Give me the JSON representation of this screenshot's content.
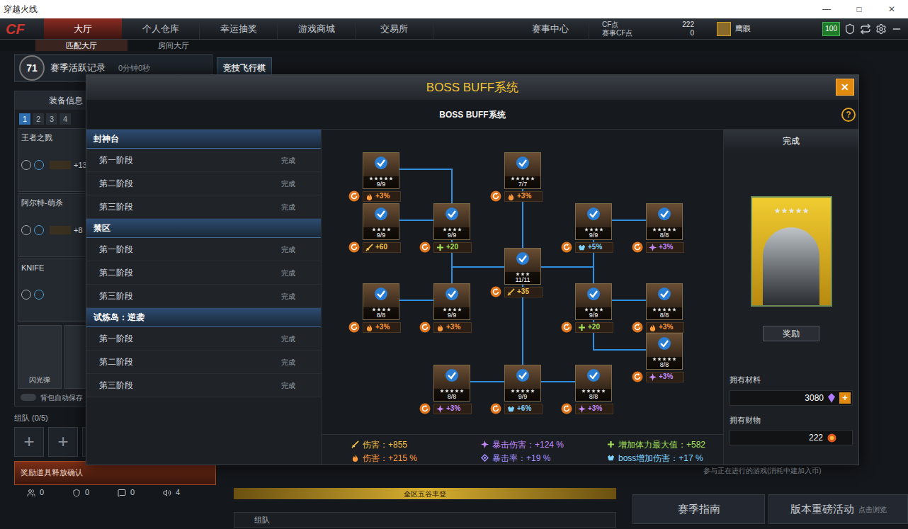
{
  "window": {
    "title": "穿越火线",
    "controls": [
      "—",
      "□",
      "✕"
    ]
  },
  "nav": {
    "logo": "CF",
    "tabs": [
      {
        "label": "大厅",
        "selected": true
      },
      {
        "label": "个人仓库",
        "selected": false
      },
      {
        "label": "幸运抽奖",
        "selected": false
      },
      {
        "label": "游戏商城",
        "selected": false
      },
      {
        "label": "交易所",
        "selected": false
      },
      {
        "label": "赛事中心",
        "selected": false
      }
    ],
    "currencies": [
      {
        "label": "CF点",
        "value": "222"
      },
      {
        "label": "赛事CF点",
        "value": "0"
      }
    ],
    "player": "鹰眼",
    "level_badge": "100",
    "subtabs": [
      {
        "label": "匹配大厅",
        "selected": true
      },
      {
        "label": "房间大厅",
        "selected": false
      }
    ]
  },
  "season": {
    "rank": "71",
    "label": "赛季活跃记录",
    "time": "0分钟0秒",
    "feature": "竞技飞行棋"
  },
  "equipment": {
    "title": "装备信息",
    "slots": [
      {
        "label": "1",
        "selected": true
      },
      {
        "label": "2",
        "selected": false
      },
      {
        "label": "3",
        "selected": false
      },
      {
        "label": "4",
        "selected": false
      }
    ],
    "weapons": [
      {
        "name": "王者之戮",
        "bonus": "+13"
      },
      {
        "name": "阿尔特-萌杀",
        "bonus": "+8"
      },
      {
        "name": "KNIFE"
      }
    ],
    "grenades": [
      "闪光弹"
    ],
    "autosave": {
      "label": "背包自动保存",
      "on": false
    }
  },
  "team": {
    "title": "组队 (0/5)",
    "slots": [
      "+",
      "+",
      "+",
      "+"
    ],
    "notice": "奖励道具释放确认",
    "counters": [
      "0",
      "0",
      "0",
      "4"
    ]
  },
  "bottom": {
    "chat_label": "组队",
    "ticker": "全区五谷丰登",
    "info": "参与正在进行的游戏(消耗中建加入币)",
    "buttons": [
      "赛季指南",
      "版本重磅活动"
    ],
    "hint": "点击浏览"
  },
  "modal": {
    "title": "BOSS BUFF系统",
    "close": "✕",
    "heading": "BOSS BUFF系统",
    "help": "?",
    "stages": [
      {
        "name": "封神台",
        "phases": [
          {
            "label": "第一阶段",
            "status": "完成"
          },
          {
            "label": "第二阶段",
            "status": "完成"
          },
          {
            "label": "第三阶段",
            "status": "完成"
          }
        ]
      },
      {
        "name": "禁区",
        "phases": [
          {
            "label": "第一阶段",
            "status": "完成"
          },
          {
            "label": "第二阶段",
            "status": "完成"
          },
          {
            "label": "第三阶段",
            "status": "完成"
          }
        ]
      },
      {
        "name": "试炼岛：逆袭",
        "phases": [
          {
            "label": "第一阶段",
            "status": "完成"
          },
          {
            "label": "第二阶段",
            "status": "完成"
          },
          {
            "label": "第三阶段",
            "status": "完成"
          }
        ]
      }
    ],
    "nodes": [
      {
        "count": "9/9",
        "stars": 5,
        "completed": true,
        "bonus": "+3%",
        "kind": "fire"
      },
      {
        "count": "9/9",
        "stars": 4,
        "completed": true,
        "bonus": "+60",
        "kind": "sword"
      },
      {
        "count": "9/9",
        "stars": 4,
        "completed": true,
        "bonus": "+20",
        "kind": "plus"
      },
      {
        "count": "7/7",
        "stars": 5,
        "completed": true,
        "bonus": "+3%",
        "kind": "fire"
      },
      {
        "count": "11/11",
        "stars": 3,
        "completed": true,
        "bonus": "+35",
        "kind": "sword"
      },
      {
        "count": "9/9",
        "stars": 4,
        "completed": true,
        "bonus": "+5%",
        "kind": "boss"
      },
      {
        "count": "8/8",
        "stars": 5,
        "completed": true,
        "bonus": "+3%",
        "kind": "crit"
      },
      {
        "count": "8/8",
        "stars": 4,
        "completed": true,
        "bonus": "+3%",
        "kind": "fire"
      },
      {
        "count": "9/9",
        "stars": 4,
        "completed": true,
        "bonus": "+3%",
        "kind": "fire"
      },
      {
        "count": "9/9",
        "stars": 4,
        "completed": true,
        "bonus": "+20",
        "kind": "plus"
      },
      {
        "count": "8/8",
        "stars": 5,
        "completed": true,
        "bonus": "+3%",
        "kind": "fire"
      },
      {
        "count": "8/8",
        "stars": 5,
        "completed": true,
        "bonus": "+3%",
        "kind": "crit"
      },
      {
        "count": "8/8",
        "stars": 5,
        "completed": true,
        "bonus": "+3%",
        "kind": "crit"
      },
      {
        "count": "9/9",
        "stars": 5,
        "completed": true,
        "bonus": "+6%",
        "kind": "boss"
      },
      {
        "count": "8/8",
        "stars": 5,
        "completed": true,
        "bonus": "+3%",
        "kind": "crit"
      }
    ],
    "stats": [
      {
        "text": "伤害：+855",
        "kind": "sword"
      },
      {
        "text": "伤害：+215 %",
        "kind": "fire"
      },
      {
        "text": "暴击伤害：+124 %",
        "kind": "crit"
      },
      {
        "text": "暴击率：+19 %",
        "kind": "critrate"
      },
      {
        "text": "增加体力最大值：+582",
        "kind": "plus"
      },
      {
        "text": "boss增加伤害：+17 %",
        "kind": "boss"
      }
    ],
    "status": "完成",
    "portrait_stars": 5,
    "reward_button": "奖励",
    "materials": {
      "label": "拥有材料",
      "value": "3080",
      "add": "+"
    },
    "wealth": {
      "label": "拥有财物",
      "value": "222"
    }
  }
}
